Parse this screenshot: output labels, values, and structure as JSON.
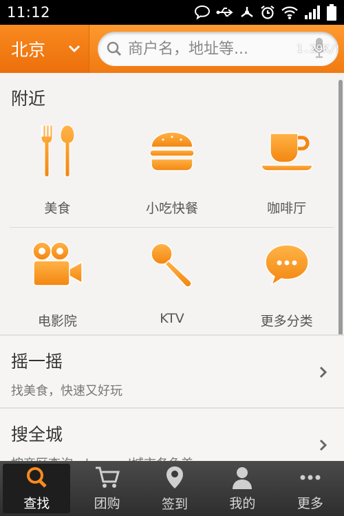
{
  "status_bar": {
    "time": "11:12"
  },
  "header": {
    "city": "北京",
    "search_placeholder": "商户名，地址等...",
    "net_speed": "1.29K/S"
  },
  "nearby": {
    "title": "附近",
    "categories": [
      {
        "label": "美食",
        "icon": "fork-spoon-icon"
      },
      {
        "label": "小吃快餐",
        "icon": "burger-icon"
      },
      {
        "label": "咖啡厅",
        "icon": "coffee-cup-icon"
      },
      {
        "label": "电影院",
        "icon": "movie-camera-icon"
      },
      {
        "label": "KTV",
        "icon": "microphone-icon"
      },
      {
        "label": "更多分类",
        "icon": "more-bubble-icon"
      }
    ]
  },
  "shake": {
    "title": "摇一摇",
    "subtitle": "找美食，快速又好玩"
  },
  "city_search": {
    "title": "搜全城",
    "subtitle": "按商区查询，beyond城市各色美..."
  },
  "tabs": [
    {
      "label": "查找",
      "icon": "search-icon",
      "active": true
    },
    {
      "label": "团购",
      "icon": "cart-icon",
      "active": false
    },
    {
      "label": "签到",
      "icon": "location-pin-icon",
      "active": false
    },
    {
      "label": "我的",
      "icon": "user-icon",
      "active": false
    },
    {
      "label": "更多",
      "icon": "more-dots-icon",
      "active": false
    }
  ],
  "colors": {
    "brand_orange": "#f98a1f",
    "icon_orange": "#f9961e"
  }
}
